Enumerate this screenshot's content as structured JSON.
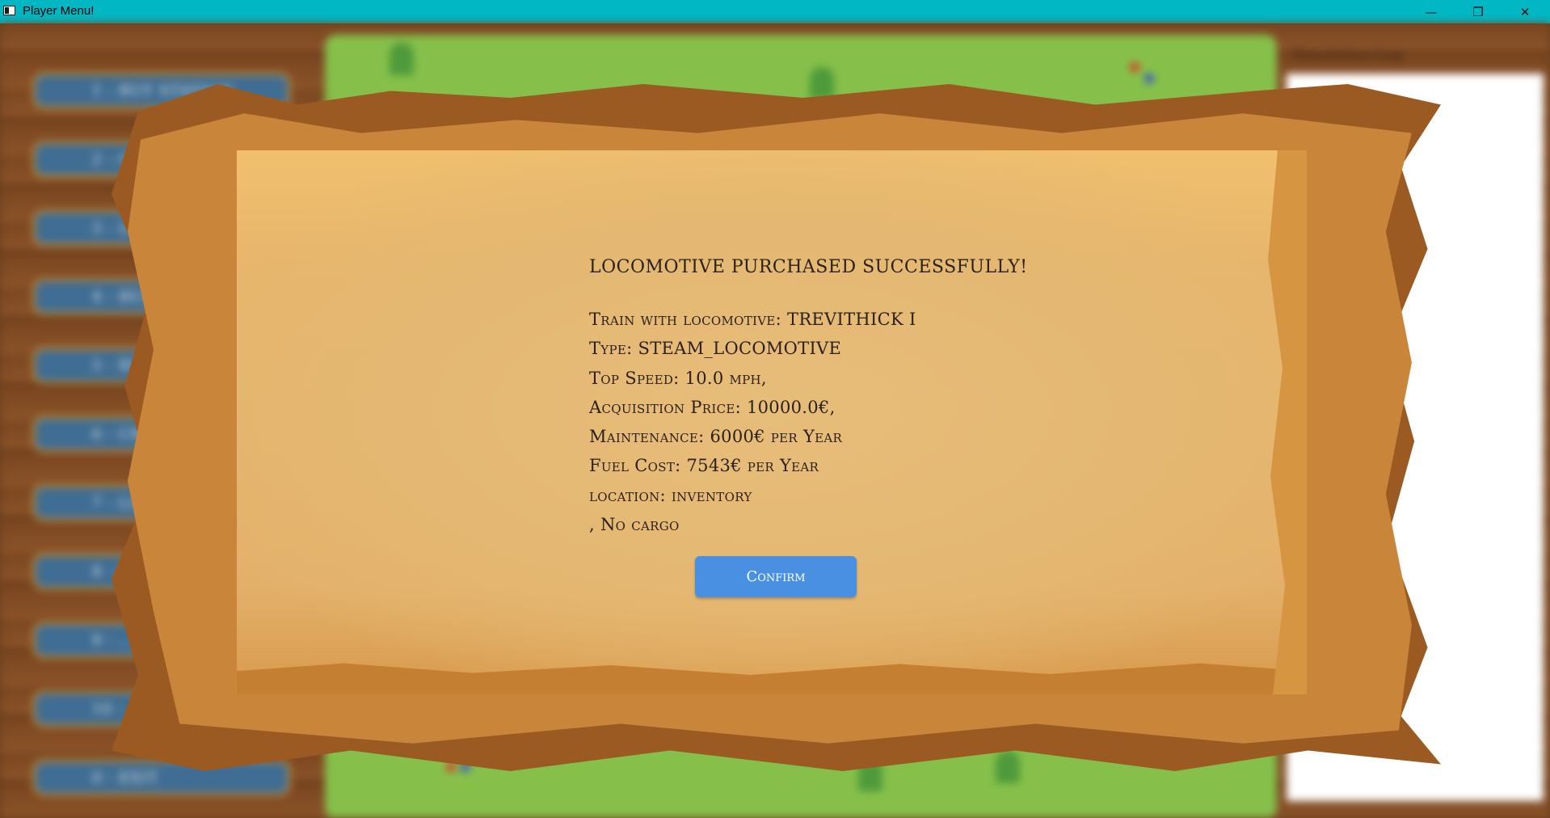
{
  "window": {
    "title": "Player Menu!",
    "controls": {
      "minimize": "—",
      "maximize": "❐",
      "close": "✕"
    }
  },
  "background": {
    "menu_items": [
      "1 - BUY STATION",
      "2 - CREATE",
      "3 - LIST ALL",
      "4 - BUILD RAIL",
      "5 - BUY TRAIN",
      "6 - CREATE",
      "7 - LIST ALL",
      "8 - PLAY",
      "9 - ...",
      "10 - ...",
      "0 - EXIT"
    ],
    "log_title": "Simulation Log"
  },
  "dialog": {
    "headline": "LOCOMOTIVE PURCHASED SUCCESSFULLY!",
    "lines": [
      "Train with locomotive:  TREVITHICK I",
      "Type:  STEAM_LOCOMOTIVE",
      "Top Speed:  10.0 mph,",
      "Acquisition Price:  10000.0€,",
      "Maintenance:  6000€ per Year",
      "Fuel Cost:  7543€ per Year",
      "location:  inventory",
      ", No cargo"
    ],
    "confirm_label": "Confirm"
  }
}
